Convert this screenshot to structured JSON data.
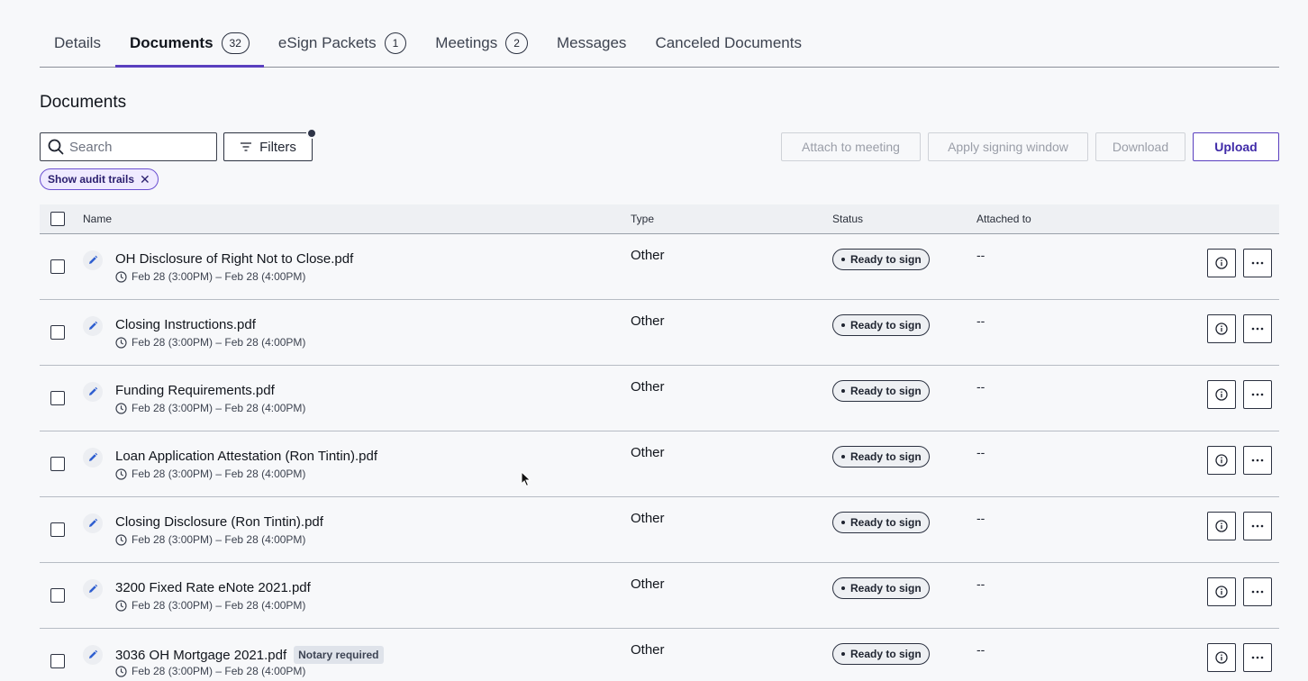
{
  "tabs": [
    {
      "label": "Details",
      "count": null,
      "active": false
    },
    {
      "label": "Documents",
      "count": "32",
      "active": true
    },
    {
      "label": "eSign Packets",
      "count": "1",
      "active": false
    },
    {
      "label": "Meetings",
      "count": "2",
      "active": false
    },
    {
      "label": "Messages",
      "count": null,
      "active": false
    },
    {
      "label": "Canceled Documents",
      "count": null,
      "active": false
    }
  ],
  "section_title": "Documents",
  "search": {
    "placeholder": "Search",
    "value": ""
  },
  "toolbar": {
    "filters_label": "Filters",
    "attach_label": "Attach to meeting",
    "signing_window_label": "Apply signing window",
    "download_label": "Download",
    "upload_label": "Upload"
  },
  "chip": {
    "label": "Show audit trails",
    "close": "✕"
  },
  "table": {
    "headers": {
      "name": "Name",
      "type": "Type",
      "status": "Status",
      "attached": "Attached to"
    },
    "rows": [
      {
        "name": "OH Disclosure of Right Not to Close.pdf",
        "badge": null,
        "window": "Feb 28 (3:00PM) – Feb 28 (4:00PM)",
        "type": "Other",
        "status": "Ready to sign",
        "attached": "--"
      },
      {
        "name": "Closing Instructions.pdf",
        "badge": null,
        "window": "Feb 28 (3:00PM) – Feb 28 (4:00PM)",
        "type": "Other",
        "status": "Ready to sign",
        "attached": "--"
      },
      {
        "name": "Funding Requirements.pdf",
        "badge": null,
        "window": "Feb 28 (3:00PM) – Feb 28 (4:00PM)",
        "type": "Other",
        "status": "Ready to sign",
        "attached": "--"
      },
      {
        "name": "Loan Application Attestation (Ron Tintin).pdf",
        "badge": null,
        "window": "Feb 28 (3:00PM) – Feb 28 (4:00PM)",
        "type": "Other",
        "status": "Ready to sign",
        "attached": "--"
      },
      {
        "name": "Closing Disclosure (Ron Tintin).pdf",
        "badge": null,
        "window": "Feb 28 (3:00PM) – Feb 28 (4:00PM)",
        "type": "Other",
        "status": "Ready to sign",
        "attached": "--"
      },
      {
        "name": "3200 Fixed Rate eNote 2021.pdf",
        "badge": null,
        "window": "Feb 28 (3:00PM) – Feb 28 (4:00PM)",
        "type": "Other",
        "status": "Ready to sign",
        "attached": "--"
      },
      {
        "name": "3036 OH Mortgage 2021.pdf",
        "badge": "Notary required",
        "window": "Feb 28 (3:00PM) – Feb 28 (4:00PM)",
        "type": "Other",
        "status": "Ready to sign",
        "attached": "--"
      }
    ]
  },
  "colors": {
    "accent": "#5a3fbf",
    "chip_bg": "#efeaff",
    "pen": "#2f5fd0"
  },
  "icons": {
    "search": "search-icon",
    "filter": "filter-icon",
    "pen": "pencil-icon",
    "clock": "clock-icon",
    "info": "info-icon",
    "more": "more-icon"
  }
}
